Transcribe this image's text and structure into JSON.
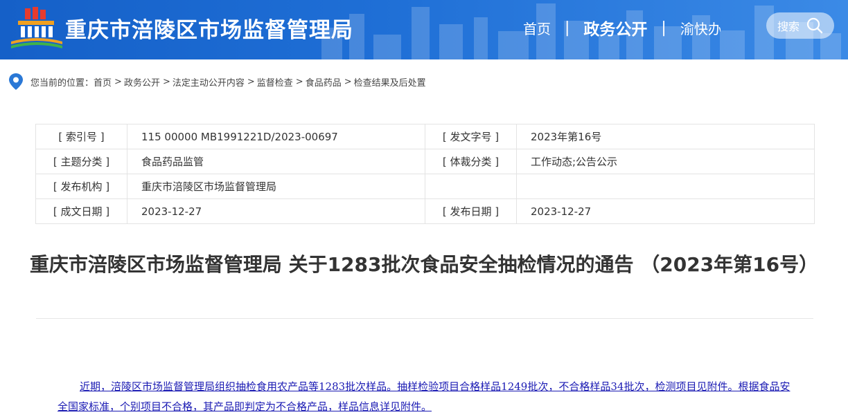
{
  "header": {
    "site_title": "重庆市涪陵区市场监督管理局",
    "nav": [
      {
        "label": "首页"
      },
      {
        "label": "政务公开"
      },
      {
        "label": "渝快办"
      }
    ],
    "search_label": "搜索",
    "colors": {
      "header_bg": "#1f6fd6"
    }
  },
  "breadcrumb": {
    "prefix": "您当前的位置：",
    "items": [
      "首页",
      "政务公开",
      "法定主动公开内容",
      "监督检查",
      "食品药品",
      "检查结果及后处置"
    ],
    "separator": ">"
  },
  "info": {
    "rows": [
      {
        "l1": "[ 索引号 ]",
        "v1": "115 00000 MB1991221D/2023-00697",
        "l2": "[ 发文字号 ]",
        "v2": "2023年第16号"
      },
      {
        "l1": "[ 主题分类 ]",
        "v1": "食品药品监管",
        "l2": "[ 体裁分类 ]",
        "v2": "工作动态;公告公示"
      },
      {
        "l1": "[ 发布机构 ]",
        "v1": "重庆市涪陵区市场监督管理局",
        "l2": "",
        "v2": ""
      },
      {
        "l1": "[ 成文日期 ]",
        "v1": "2023-12-27",
        "l2": "[ 发布日期 ]",
        "v2": "2023-12-27"
      }
    ]
  },
  "article": {
    "title": "重庆市涪陵区市场监督管理局 关于1283批次食品安全抽检情况的通告 （2023年第16号）",
    "body": "近期，涪陵区市场监督管理局组织抽检食用农产品等1283批次样品。抽样检验项目合格样品1249批次，不合格样品34批次，检测项目见附件。根据食品安全国家标准，个别项目不合格，其产品即判定为不合格产品，样品信息详见附件。"
  }
}
